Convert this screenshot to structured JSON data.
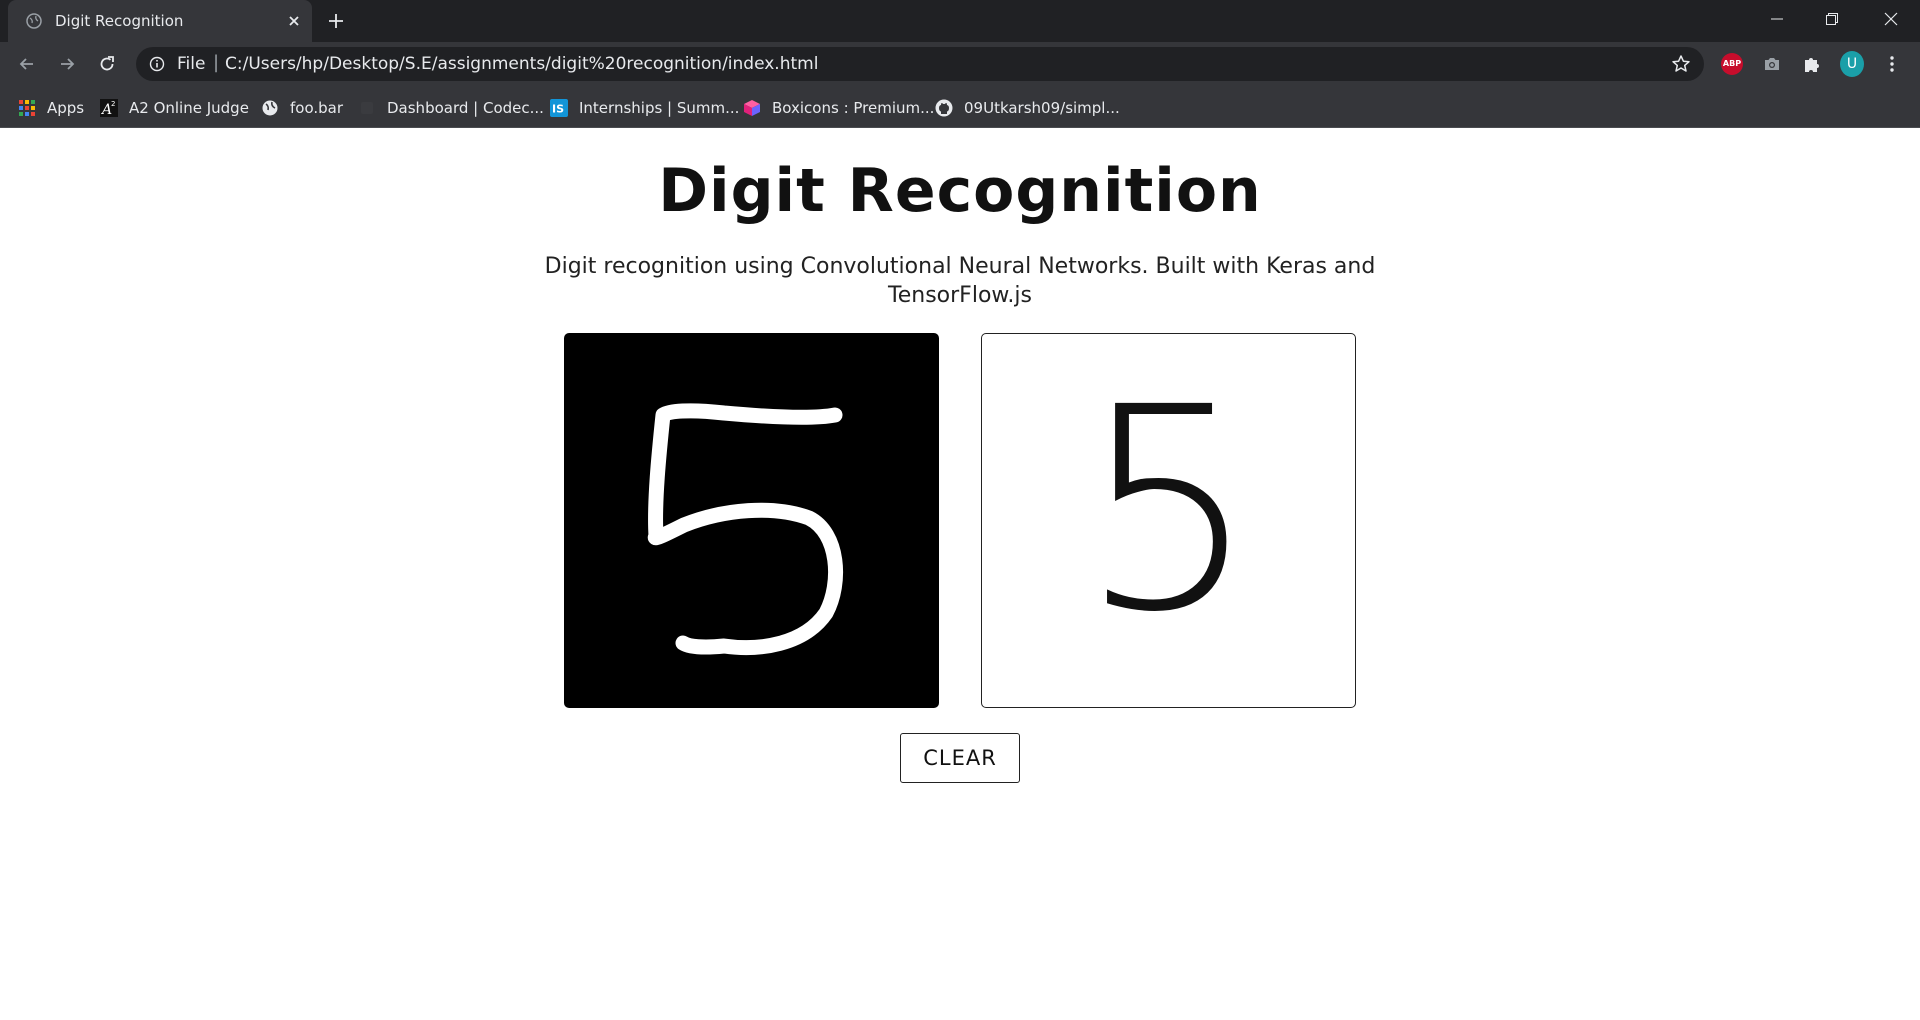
{
  "browser": {
    "tab_title": "Digit Recognition",
    "url_scheme": "File",
    "url_separator": "|",
    "url": "C:/Users/hp/Desktop/S.E/assignments/digit%20recognition/index.html",
    "avatar_letter": "U",
    "adblock_label": "ABP"
  },
  "bookmarks": [
    {
      "label": "Apps",
      "icon": "apps-grid-icon"
    },
    {
      "label": "A2 Online Judge",
      "icon": "a2-icon"
    },
    {
      "label": "foo.bar",
      "icon": "globe-icon"
    },
    {
      "label": "Dashboard | Codec...",
      "icon": "codechef-icon"
    },
    {
      "label": "Internships | Summ...",
      "icon": "internshala-icon"
    },
    {
      "label": "Boxicons : Premium...",
      "icon": "boxicons-icon"
    },
    {
      "label": "09Utkarsh09/simpl...",
      "icon": "github-icon"
    }
  ],
  "page": {
    "title": "Digit Recognition",
    "subtitle": "Digit recognition using Convolutional Neural Networks. Built with Keras and TensorFlow.js",
    "prediction": "5",
    "clear_label": "CLEAR"
  },
  "colors": {
    "chrome_dark": "#202124",
    "chrome_mid": "#35363a",
    "canvas_bg": "#000000",
    "stroke": "#ffffff",
    "avatar": "#1a9fa8",
    "abp": "#c70d2c"
  }
}
